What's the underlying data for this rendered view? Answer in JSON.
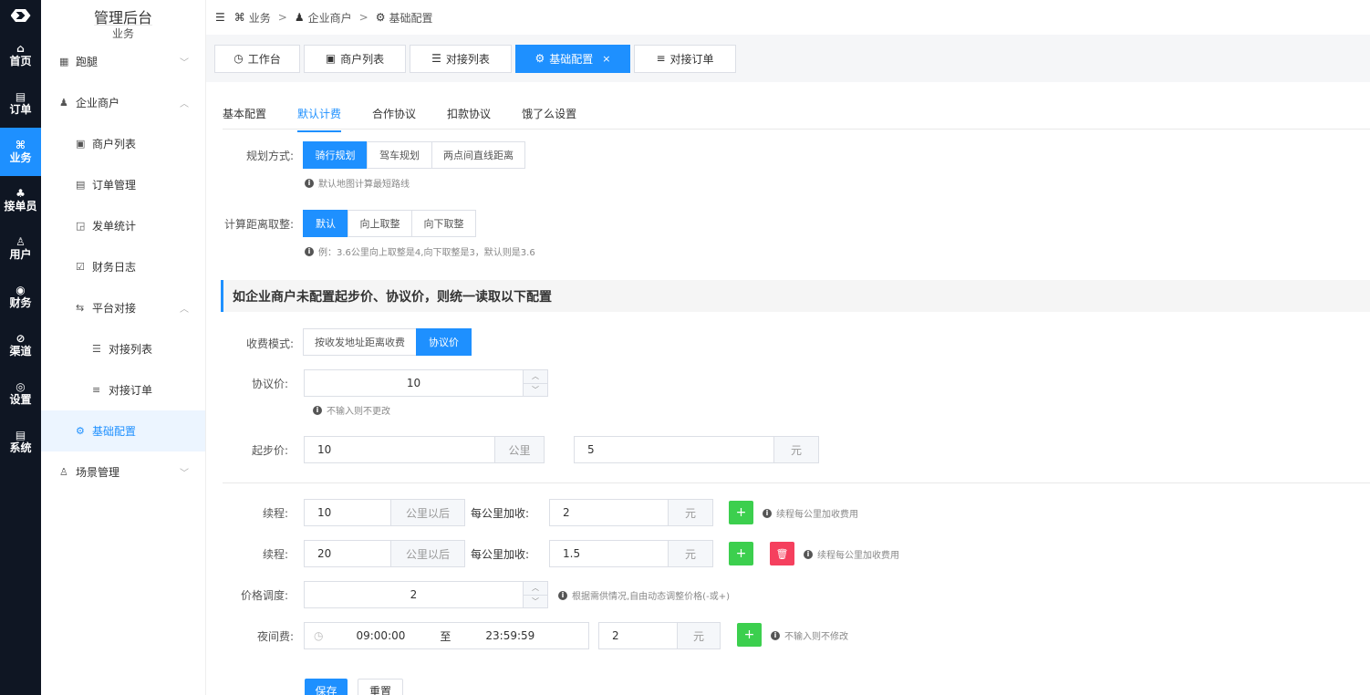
{
  "rail": {
    "items": [
      {
        "icon": "⌂",
        "label": "首页"
      },
      {
        "icon": "▤",
        "label": "订单"
      },
      {
        "icon": "⌘",
        "label": "业务"
      },
      {
        "icon": "♣",
        "label": "接单员"
      },
      {
        "icon": "♙",
        "label": "用户"
      },
      {
        "icon": "◉",
        "label": "财务"
      },
      {
        "icon": "⊘",
        "label": "渠道"
      },
      {
        "icon": "◎",
        "label": "设置"
      },
      {
        "icon": "▤",
        "label": "系统"
      }
    ]
  },
  "sidebar": {
    "title": "管理后台",
    "subtitle": "业务",
    "items": [
      {
        "icon": "▦",
        "label": "跑腿",
        "chev": "﹀"
      },
      {
        "icon": "♟",
        "label": "企业商户",
        "chev": "︿"
      },
      {
        "icon": "▣",
        "label": "商户列表"
      },
      {
        "icon": "▤",
        "label": "订单管理"
      },
      {
        "icon": "◲",
        "label": "发单统计"
      },
      {
        "icon": "☑",
        "label": "财务日志"
      },
      {
        "icon": "⇆",
        "label": "平台对接",
        "chev": "︿"
      },
      {
        "icon": "☰",
        "label": "对接列表"
      },
      {
        "icon": "≡",
        "label": "对接订单"
      },
      {
        "icon": "⚙",
        "label": "基础配置"
      },
      {
        "icon": "♙",
        "label": "场景管理",
        "chev": "﹀"
      }
    ]
  },
  "header": {
    "menu_icon": "☰",
    "crumbs": [
      {
        "icon": "⌘",
        "label": "业务"
      },
      {
        "icon": "♟",
        "label": "企业商户"
      },
      {
        "icon": "⚙",
        "label": "基础配置"
      }
    ],
    "separator": ">"
  },
  "tabs": [
    {
      "icon": "◷",
      "label": "工作台"
    },
    {
      "icon": "▣",
      "label": "商户列表"
    },
    {
      "icon": "☰",
      "label": "对接列表"
    },
    {
      "icon": "⚙",
      "label": "基础配置",
      "close": "×"
    },
    {
      "icon": "≡",
      "label": "对接订单"
    }
  ],
  "subtabs": [
    "基本配置",
    "默认计费",
    "合作协议",
    "扣款协议",
    "饿了么设置"
  ],
  "form": {
    "plan_label": "规划方式:",
    "plan_options": [
      "骑行规划",
      "驾车规划",
      "两点间直线距离"
    ],
    "plan_hint": "默认地图计算最短路线",
    "round_label": "计算距离取整:",
    "round_options": [
      "默认",
      "向上取整",
      "向下取整"
    ],
    "round_hint": "例：3.6公里向上取整是4,向下取整是3，默认则是3.6",
    "section_title": "如企业商户未配置起步价、协议价，则统一读取以下配置",
    "mode_label": "收费模式:",
    "mode_options": [
      "按收发地址距离收费",
      "协议价"
    ],
    "agree_label": "协议价:",
    "agree_value": "10",
    "agree_hint": "不输入则不更改",
    "start_label": "起步价:",
    "start_km": "10",
    "start_km_unit": "公里",
    "start_price": "5",
    "start_price_unit": "元",
    "ext_label": "续程:",
    "ext_rows": [
      {
        "km": "10",
        "km_unit": "公里以后",
        "add_label": "每公里加收:",
        "price": "2",
        "unit": "元",
        "hint": "续程每公里加收费用"
      },
      {
        "km": "20",
        "km_unit": "公里以后",
        "add_label": "每公里加收:",
        "price": "1.5",
        "unit": "元",
        "hint": "续程每公里加收费用"
      }
    ],
    "adjust_label": "价格调度:",
    "adjust_value": "2",
    "adjust_hint": "根据需供情况,自由动态调整价格(-或+)",
    "night_label": "夜间费:",
    "night_start": "09:00:00",
    "night_to": "至",
    "night_end": "23:59:59",
    "night_price": "2",
    "night_unit": "元",
    "night_hint": "不输入则不修改",
    "plus": "+",
    "delete": "🗑",
    "up": "︿",
    "down": "﹀",
    "clock": "◷",
    "info": "i",
    "save": "保存",
    "reset": "重置"
  }
}
